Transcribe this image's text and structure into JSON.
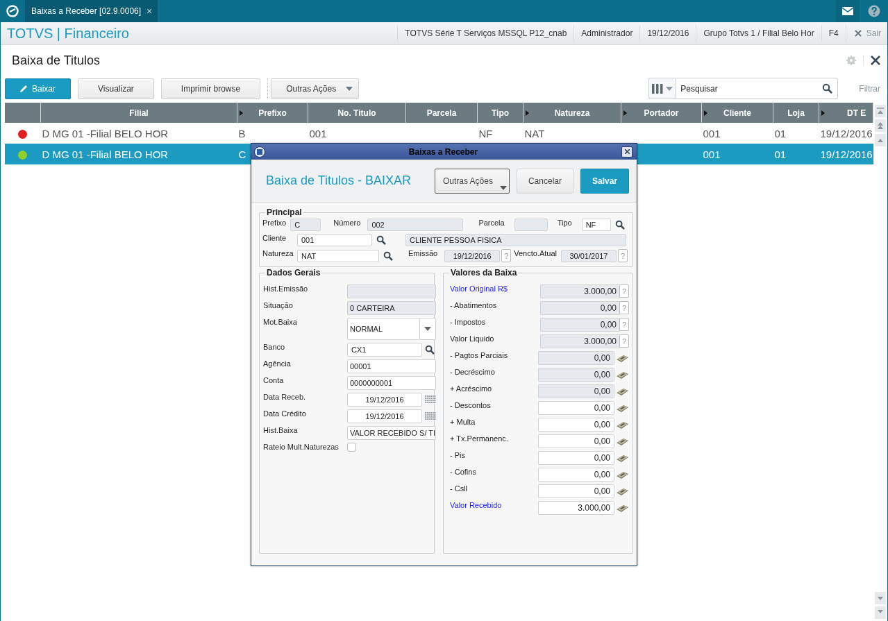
{
  "app_bar": {
    "tab": {
      "label": "Baixas a Receber [02.9.0006]",
      "close": "×"
    }
  },
  "header": {
    "brand": "TOTVS | Financeiro",
    "info": [
      "TOTVS Série T Serviços MSSQL P12_cnab",
      "Administrador",
      "19/12/2016",
      "Grupo Totvs 1 / Filial Belo Hor",
      "F4"
    ],
    "exit": "Sair"
  },
  "page": {
    "title": "Baixa de Titulos"
  },
  "toolbar": {
    "buttons": [
      {
        "label": "Baixar",
        "kind": "primary"
      },
      {
        "label": "Visualizar",
        "kind": "normal"
      },
      {
        "label": "Imprimir browse",
        "kind": "normal"
      },
      {
        "label": "Outras Ações",
        "kind": "dropdown"
      }
    ],
    "search": {
      "placeholder": "Pesquisar"
    },
    "filter": "Filtrar"
  },
  "table": {
    "columns": [
      {
        "label": "Filial",
        "marker": false
      },
      {
        "label": "Prefixo",
        "marker": true
      },
      {
        "label": "No. Titulo",
        "marker": false
      },
      {
        "label": "Parcela",
        "marker": false
      },
      {
        "label": "Tipo",
        "marker": false
      },
      {
        "label": "Natureza",
        "marker": true
      },
      {
        "label": "Portador",
        "marker": true
      },
      {
        "label": "Cliente",
        "marker": true
      },
      {
        "label": "Loja",
        "marker": false
      },
      {
        "label": "DT E",
        "marker": true
      }
    ],
    "rows": [
      {
        "color": "#e02020",
        "selected": false,
        "cells": [
          "D MG 01 -Filial BELO HOR",
          "B",
          "001",
          null,
          "NF",
          "NAT",
          null,
          "001",
          "01",
          "19/12/2016"
        ]
      },
      {
        "color": "#8fd12a",
        "selected": true,
        "cells": [
          "D MG 01 -Filial BELO HOR",
          "C",
          null,
          null,
          null,
          null,
          null,
          "001",
          "01",
          "19/12/2016"
        ]
      }
    ]
  },
  "dialog": {
    "title": "Baixas a Receber",
    "heading": "Baixa de Titulos - BAIXAR",
    "buttons": [
      {
        "label": "Outras Ações",
        "kind": "dropdown"
      },
      {
        "label": "Cancelar",
        "kind": "normal"
      },
      {
        "label": "Salvar",
        "kind": "primary"
      }
    ],
    "principal": {
      "title": "Principal",
      "fields": [
        {
          "kind": "plain",
          "label": "Prefixo",
          "value": "C",
          "readonly": true
        },
        {
          "kind": "plain",
          "label": "Número",
          "value": "002",
          "readonly": true
        },
        {
          "kind": "plain",
          "label": "Parcela",
          "readonly": true
        },
        {
          "kind": "lookup",
          "label": "Tipo",
          "value": "NF",
          "readonly": false
        },
        {
          "kind": "lookup",
          "label": "Cliente",
          "value": "001",
          "readonly": false
        },
        {
          "kind": "plain",
          "value": "CLIENTE PESSOA FISICA",
          "readonly": true
        },
        {
          "kind": "lookup",
          "label": "Natureza",
          "value": "NAT",
          "readonly": false
        },
        {
          "kind": "help",
          "label": "Emissão",
          "value": "19/12/2016",
          "readonly": true,
          "help": "?"
        },
        {
          "kind": "help",
          "label": "Vencto.Atual",
          "value": "30/01/2017",
          "readonly": true,
          "help": "?"
        }
      ]
    },
    "general": {
      "title": "Dados Gerais",
      "fields": [
        {
          "kind": "text",
          "label": "Hist.Emissão",
          "readonly": true
        },
        {
          "kind": "text",
          "label": "Situação",
          "value": "0 CARTEIRA",
          "readonly": true
        },
        {
          "kind": "select",
          "label": "Mot.Baixa",
          "value": "NORMAL",
          "readonly": false
        },
        {
          "kind": "lookup",
          "label": "Banco",
          "value": "CX1",
          "readonly": false
        },
        {
          "kind": "text",
          "label": "Agência",
          "value": "00001",
          "readonly": false
        },
        {
          "kind": "text",
          "label": "Conta",
          "value": "0000000001",
          "readonly": false
        },
        {
          "kind": "date",
          "label": "Data Receb.",
          "value": "19/12/2016",
          "readonly": false
        },
        {
          "kind": "date",
          "label": "Data Crédito",
          "value": "19/12/2016",
          "readonly": false
        },
        {
          "kind": "text",
          "label": "Hist.Baixa",
          "value": "VALOR RECEBIDO S/ TI",
          "readonly": false
        },
        {
          "kind": "checkbox",
          "label": "Rateio Mult.Naturezas",
          "checked": false
        }
      ]
    },
    "values": {
      "title": "Valores da Baixa",
      "fields": [
        {
          "kind": "help",
          "label": "Valor Original R$",
          "emphasis": true,
          "value": "3.000,00",
          "readonly": true,
          "help": "?"
        },
        {
          "kind": "help",
          "label": "- Abatimentos",
          "emphasis": false,
          "value": "0,00",
          "readonly": true,
          "help": "?"
        },
        {
          "kind": "help",
          "label": "- Impostos",
          "emphasis": false,
          "value": "0,00",
          "readonly": true,
          "help": "?"
        },
        {
          "kind": "help",
          "label": "Valor Liquido",
          "emphasis": false,
          "value": "3.000,00",
          "readonly": true,
          "help": "?"
        },
        {
          "kind": "calc",
          "label": "- Pagtos Parciais",
          "emphasis": false,
          "value": "0,00",
          "readonly": true
        },
        {
          "kind": "calc",
          "label": "- Decréscimo",
          "emphasis": false,
          "value": "0,00",
          "readonly": true
        },
        {
          "kind": "calc",
          "label": "+ Acréscimo",
          "emphasis": false,
          "value": "0,00",
          "readonly": true
        },
        {
          "kind": "calc",
          "label": "- Descontos",
          "emphasis": false,
          "value": "0,00",
          "readonly": false
        },
        {
          "kind": "calc",
          "label": "+ Multa",
          "emphasis": false,
          "value": "0,00",
          "readonly": false
        },
        {
          "kind": "calc",
          "label": "+ Tx.Permanenc.",
          "emphasis": false,
          "value": "0,00",
          "readonly": false
        },
        {
          "kind": "calc",
          "label": "- Pis",
          "emphasis": false,
          "value": "0,00",
          "readonly": false
        },
        {
          "kind": "calc",
          "label": "- Cofins",
          "emphasis": false,
          "value": "0,00",
          "readonly": false
        },
        {
          "kind": "calc",
          "label": "- Csll",
          "emphasis": false,
          "value": "0,00",
          "readonly": false
        },
        {
          "kind": "calc",
          "label": "Valor Recebido",
          "emphasis": true,
          "value": "3.000,00",
          "readonly": false
        }
      ]
    }
  }
}
